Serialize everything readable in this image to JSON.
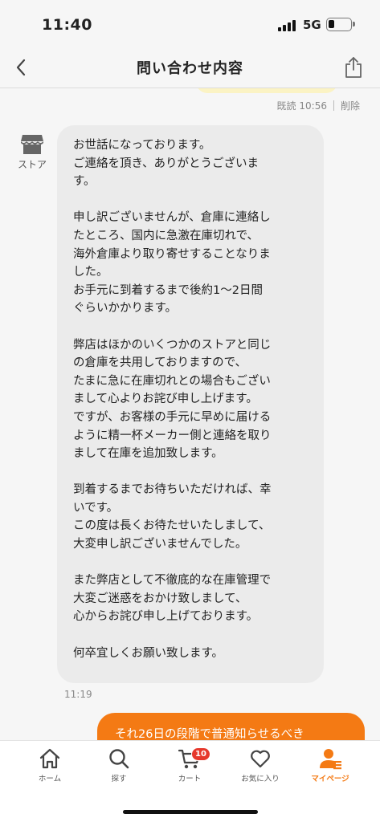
{
  "status_bar": {
    "time": "11:40",
    "network": "5G"
  },
  "header": {
    "title": "問い合わせ内容"
  },
  "read_receipt": {
    "read_label": "既読",
    "time": "10:56",
    "delete_label": "削除"
  },
  "store": {
    "label": "ストア"
  },
  "incoming_message": {
    "text": "お世話になっております。\nご連絡を頂き、ありがとうございま\nす。\n\n申し訳ございませんが、倉庫に連絡し\nたところ、国内に急激在庫切れで、\n海外倉庫より取り寄せすることなりま\nした。\nお手元に到着するまで後約1〜2日間\nぐらいかかります。\n\n弊店はほかのいくつかのストアと同じ\nの倉庫を共用しておりますので、\nたまに急に在庫切れとの場合もござい\nまして心よりお詫び申し上げます。\nですが、お客様の手元に早めに届ける\nように精一杯メーカー側と連絡を取り\nまして在庫を追加致します。\n\n到着するまでお待ちいただければ、幸\nいです。\nこの度は長くお待たせいたしまして、\n大変申し訳ございませんでした。\n\nまた弊店として不徹底的な在庫管理で\n大変ご迷惑をおかけ致しまして、\n心からお詫び申し上げております。\n\n何卒宜しくお願い致します。",
    "time": "11:19"
  },
  "outgoing_message": {
    "text": "それ26日の段階で普通知らせるべき"
  },
  "tabbar": {
    "active_color": "#f47a14",
    "items": [
      {
        "label": "ホーム",
        "icon": "home-icon"
      },
      {
        "label": "探す",
        "icon": "search-icon"
      },
      {
        "label": "カート",
        "icon": "cart-icon",
        "badge": "10"
      },
      {
        "label": "お気に入り",
        "icon": "heart-icon"
      },
      {
        "label": "マイページ",
        "icon": "person-icon",
        "active": true
      }
    ]
  }
}
